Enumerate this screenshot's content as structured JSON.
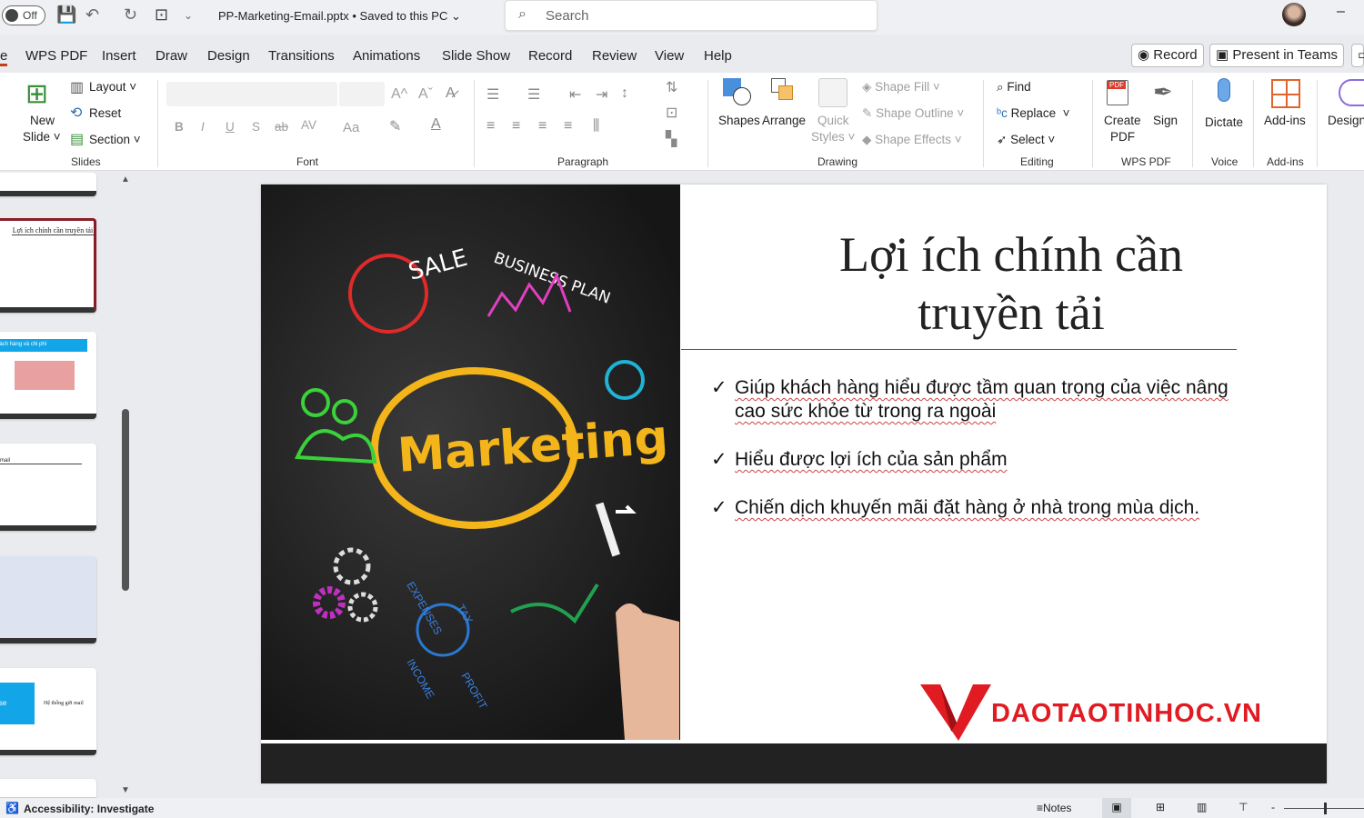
{
  "titlebar": {
    "autosave": "Off",
    "doc_title": "PP-Marketing-Email.pptx • Saved to this PC ⌄",
    "search_placeholder": "Search",
    "minimize": "–"
  },
  "tabs": [
    "e",
    "WPS PDF",
    "Insert",
    "Draw",
    "Design",
    "Transitions",
    "Animations",
    "Slide Show",
    "Record",
    "Review",
    "View",
    "Help"
  ],
  "tab_buttons": {
    "record": "Record",
    "present": "Present in Teams"
  },
  "ribbon": {
    "slides": {
      "new_slide": "New",
      "new_slide2": "Slide ˅",
      "layout": "Layout ˅",
      "reset": "Reset",
      "section": "Section ˅",
      "group": "Slides"
    },
    "font": {
      "group": "Font",
      "bold": "B",
      "italic": "I",
      "underline": "U",
      "shadow": "S",
      "strike": "ab",
      "spacing": "AV",
      "case": "Aa",
      "grow": "A^",
      "shrink": "Aˇ"
    },
    "paragraph": {
      "group": "Paragraph"
    },
    "drawing": {
      "shapes": "Shapes",
      "arrange": "Arrange",
      "quick_styles": "Quick",
      "quick_styles2": "Styles ˅",
      "shape_fill": "Shape Fill ˅",
      "shape_outline": "Shape Outline ˅",
      "shape_effects": "Shape Effects ˅",
      "group": "Drawing"
    },
    "editing": {
      "find": "Find",
      "replace": "Replace",
      "select": "Select ˅",
      "group": "Editing"
    },
    "wps": {
      "create": "Create",
      "create2": "PDF",
      "sign": "Sign",
      "group": "WPS PDF"
    },
    "voice": {
      "dictate": "Dictate",
      "group": "Voice"
    },
    "addins": {
      "addins": "Add-ins",
      "group": "Add-ins"
    },
    "designer": {
      "label": "Design"
    }
  },
  "thumbnails": [
    {
      "title": ""
    },
    {
      "title": "Lợi ích chính cần truyền tải"
    },
    {
      "title": "khách hàng và chi phí"
    },
    {
      "title": "mail"
    },
    {
      "title": ""
    },
    {
      "title": "onse",
      "caption": "Hệ thống gửi mail"
    },
    {
      "title": ""
    }
  ],
  "slide": {
    "image_words": {
      "center": "Marketing",
      "sale": "SALE",
      "business": "BUSINESS PLAN",
      "expenses": "EXPENSES",
      "tax": "TAX",
      "income": "INCOME",
      "profit": "PROFIT"
    },
    "title_line1": "Lợi ích chính cần",
    "title_line2": "truyền tải",
    "bullets": [
      "Giúp khách hàng hiểu được tầm quan trọng của việc nâng cao sức khỏe từ trong ra ngoài",
      "Hiểu được lợi ích của sản phẩm",
      "Chiến dịch khuyến mãi đặt hàng ở nhà trong mùa dịch."
    ],
    "check": "✓",
    "logo_text": "DAOTAOTINHOC.VN"
  },
  "status": {
    "accessibility": "Accessibility: Investigate",
    "notes": "Notes"
  },
  "colors": {
    "accent": "#c43e1c",
    "logo": "#e01b22",
    "selected_thumb": "#8a1c2a"
  }
}
